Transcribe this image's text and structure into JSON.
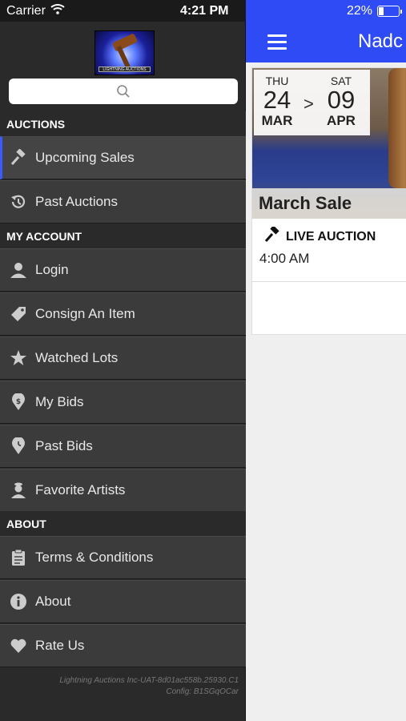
{
  "status_bar": {
    "carrier": "Carrier",
    "time": "4:21 PM",
    "battery_percent": "22%",
    "battery_level": 0.22
  },
  "drawer": {
    "logo_text": "LIGHTNING AUCTIONS",
    "search": {
      "placeholder": ""
    },
    "sections": [
      {
        "title": "AUCTIONS",
        "items": [
          {
            "label": "Upcoming Sales",
            "icon": "gavel-icon",
            "active": true
          },
          {
            "label": "Past Auctions",
            "icon": "history-icon",
            "active": false
          }
        ]
      },
      {
        "title": "MY ACCOUNT",
        "items": [
          {
            "label": "Login",
            "icon": "person-icon"
          },
          {
            "label": "Consign An Item",
            "icon": "tag-icon"
          },
          {
            "label": "Watched Lots",
            "icon": "star-icon"
          },
          {
            "label": "My Bids",
            "icon": "dollar-pin-icon"
          },
          {
            "label": "Past Bids",
            "icon": "clock-pin-icon"
          },
          {
            "label": "Favorite Artists",
            "icon": "artist-icon"
          }
        ]
      },
      {
        "title": "ABOUT",
        "items": [
          {
            "label": "Terms & Conditions",
            "icon": "clipboard-icon"
          },
          {
            "label": "About",
            "icon": "info-icon"
          },
          {
            "label": "Rate Us",
            "icon": "heart-icon"
          }
        ]
      }
    ],
    "footer_line1": "Lightning Auctions Inc-UAT-8d01ac558b.25930.C1",
    "footer_line2": "Config: B1SGqOCar"
  },
  "main": {
    "nav_title": "Nadc",
    "card": {
      "start_dow": "THU",
      "start_day": "24",
      "start_month": "MAR",
      "arrow": ">",
      "end_dow": "SAT",
      "end_day": "09",
      "end_month": "APR",
      "title": "March Sale",
      "type_label": "LIVE AUCTION",
      "time": "4:00 AM"
    }
  },
  "colors": {
    "accent": "#2f4bf5",
    "drawer_bg": "#2a2a2a",
    "menu_item_bg": "#3b3b3b",
    "active_indicator": "#3b5bff"
  }
}
